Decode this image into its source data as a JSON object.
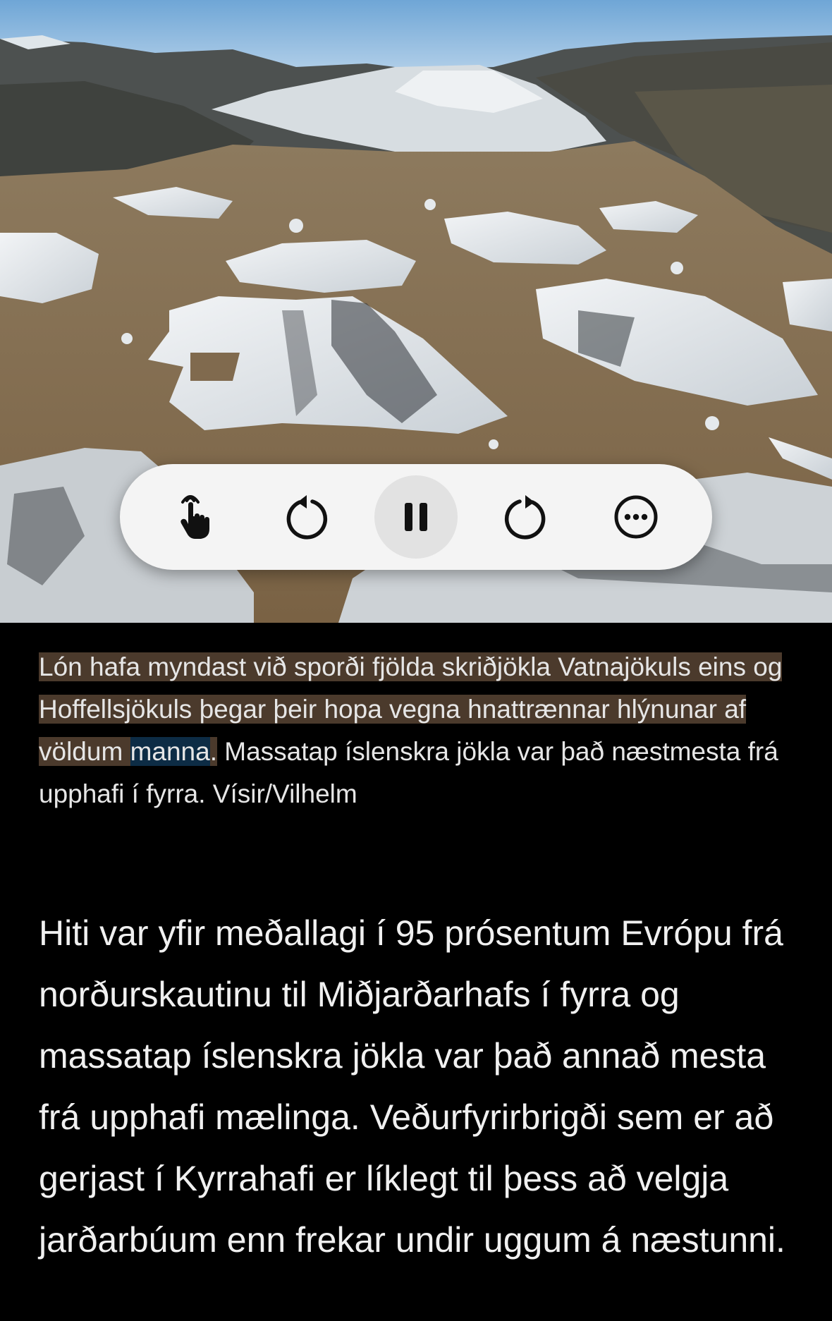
{
  "hero": {
    "icon": "glacier-lagoon-photo"
  },
  "controls": {
    "buttons": [
      {
        "icon": "pointer-hand-icon"
      },
      {
        "icon": "skip-back-icon"
      },
      {
        "icon": "pause-icon",
        "active": true
      },
      {
        "icon": "skip-forward-icon"
      },
      {
        "icon": "more-options-icon"
      }
    ]
  },
  "caption": {
    "highlighted_before": "Lón hafa myndast við sporði fjölda skriðjökla Vatnajökuls eins og Hoffellsjökuls þegar þeir hopa vegna hnattrænnar hlýnunar af völdum ",
    "current_word": "manna",
    "highlighted_after": ".",
    "rest": " Massatap íslenskra jökla var það næstmesta frá upphafi í fyrra. Vísir/Vilhelm"
  },
  "article": {
    "paragraph": "Hiti var yfir meðallagi í 95 prósentum Evrópu frá norðurskautinu til Miðjarðarhafs í fyrra og massatap íslenskra jökla var það annað mesta frá upphafi mælinga. Veðurfyrirbrigði sem er að gerjast í Kyrrahafi er líklegt til þess að velgja jarðarbúum enn frekar undir uggum á næstunni."
  },
  "colors": {
    "background": "#000000",
    "caption_highlight": "#4b3a2c",
    "current_word_highlight": "#0d2c45",
    "controls_bg": "#f4f4f4"
  }
}
